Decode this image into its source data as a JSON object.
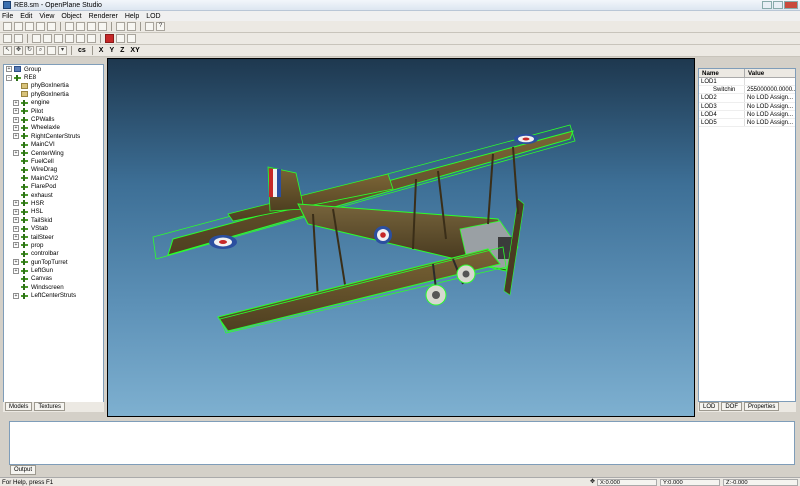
{
  "window": {
    "title": "RE8.sm - OpenPlane Studio"
  },
  "menu": [
    "File",
    "Edit",
    "View",
    "Object",
    "Renderer",
    "Help",
    "LOD"
  ],
  "toolbar3": {
    "cs_label": "cs",
    "x": "X",
    "y": "Y",
    "z": "Z",
    "xy": "XY"
  },
  "tree": [
    {
      "label": "Group",
      "icon": "group-icon",
      "exp": "+",
      "indent": 0
    },
    {
      "label": "RE8",
      "icon": "model-icon",
      "exp": "-",
      "indent": 0
    },
    {
      "label": "phyBoxInertia",
      "icon": "mesh-icon",
      "exp": "",
      "indent": 1
    },
    {
      "label": "phyBoxInertia",
      "icon": "mesh-icon",
      "exp": "",
      "indent": 1
    },
    {
      "label": "engine",
      "icon": "model-icon",
      "exp": "+",
      "indent": 1
    },
    {
      "label": "Pilot",
      "icon": "model-icon",
      "exp": "+",
      "indent": 1
    },
    {
      "label": "CPWalls",
      "icon": "model-icon",
      "exp": "+",
      "indent": 1
    },
    {
      "label": "Wheelaxle",
      "icon": "model-icon",
      "exp": "+",
      "indent": 1
    },
    {
      "label": "RightCenterStruts",
      "icon": "model-icon",
      "exp": "+",
      "indent": 1
    },
    {
      "label": "MainCVI",
      "icon": "model-icon",
      "exp": "",
      "indent": 1
    },
    {
      "label": "CenterWing",
      "icon": "model-icon",
      "exp": "+",
      "indent": 1
    },
    {
      "label": "FuelCell",
      "icon": "model-icon",
      "exp": "",
      "indent": 1
    },
    {
      "label": "WireDrag",
      "icon": "model-icon",
      "exp": "",
      "indent": 1
    },
    {
      "label": "MainCVI2",
      "icon": "model-icon",
      "exp": "",
      "indent": 1
    },
    {
      "label": "FlarePod",
      "icon": "model-icon",
      "exp": "",
      "indent": 1
    },
    {
      "label": "exhaust",
      "icon": "model-icon",
      "exp": "",
      "indent": 1
    },
    {
      "label": "HSR",
      "icon": "model-icon",
      "exp": "+",
      "indent": 1
    },
    {
      "label": "HSL",
      "icon": "model-icon",
      "exp": "+",
      "indent": 1
    },
    {
      "label": "TailSkid",
      "icon": "model-icon",
      "exp": "+",
      "indent": 1
    },
    {
      "label": "VStab",
      "icon": "model-icon",
      "exp": "+",
      "indent": 1
    },
    {
      "label": "tailSteer",
      "icon": "model-icon",
      "exp": "+",
      "indent": 1
    },
    {
      "label": "prop",
      "icon": "model-icon",
      "exp": "+",
      "indent": 1
    },
    {
      "label": "controlbar",
      "icon": "model-icon",
      "exp": "",
      "indent": 1
    },
    {
      "label": "gunTopTurret",
      "icon": "model-icon",
      "exp": "+",
      "indent": 1
    },
    {
      "label": "LeftGun",
      "icon": "model-icon",
      "exp": "+",
      "indent": 1
    },
    {
      "label": "Canvas",
      "icon": "model-icon",
      "exp": "",
      "indent": 1
    },
    {
      "label": "Windscreen",
      "icon": "model-icon",
      "exp": "",
      "indent": 1
    },
    {
      "label": "LeftCenterStruts",
      "icon": "model-icon",
      "exp": "+",
      "indent": 1
    }
  ],
  "left_tabs": [
    "Models",
    "Textures"
  ],
  "props": {
    "col_name": "Name",
    "col_value": "Value",
    "rows": [
      {
        "name": "LOD1",
        "value": ""
      },
      {
        "name": "Switchin",
        "value": "255000000.0000..."
      },
      {
        "name": "LOD2",
        "value": "No LOD Assign..."
      },
      {
        "name": "LOD3",
        "value": "No LOD Assign..."
      },
      {
        "name": "LOD4",
        "value": "No LOD Assign..."
      },
      {
        "name": "LOD5",
        "value": "No LOD Assign..."
      }
    ]
  },
  "right_tabs": [
    "LOD",
    "DOF",
    "Properties"
  ],
  "output_tab": "Output",
  "status": {
    "help": "For Help, press F1",
    "x": "X:0.000",
    "y": "Y:0.000",
    "z": "Z:-0.000"
  },
  "colors": {
    "wireframe": "#2bff2b",
    "sky_top": "#1e384f",
    "sky_bottom": "#7eb0d0"
  }
}
